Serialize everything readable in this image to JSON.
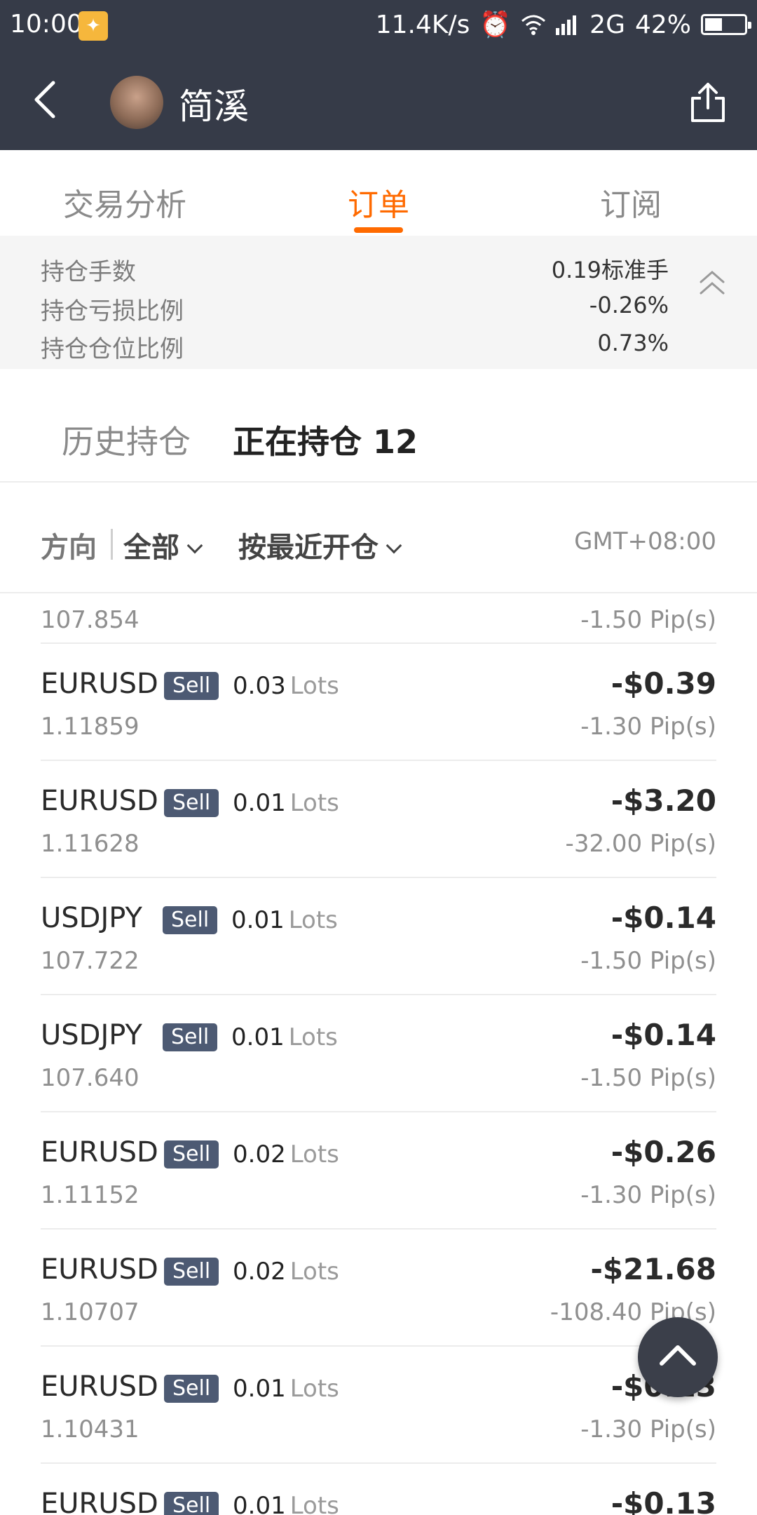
{
  "status_bar": {
    "time": "10:00",
    "speed": "11.4K/s",
    "network": "2G",
    "battery": "42%"
  },
  "header": {
    "title": "简溪",
    "icons": [
      "back-arrow-icon",
      "avatar",
      "share-icon"
    ]
  },
  "tabs": {
    "items": [
      "交易分析",
      "订单",
      "订阅"
    ],
    "active": "订单"
  },
  "summary": {
    "rows": [
      {
        "label": "持仓手数",
        "value": "0.19标准手"
      },
      {
        "label": "持仓亏损比例",
        "value": "-0.26%"
      },
      {
        "label": "持仓仓位比例",
        "value": "0.73%"
      }
    ]
  },
  "subtabs": {
    "history": "历史持仓",
    "current": "正在持仓 12"
  },
  "filter": {
    "direction_label": "方向",
    "direction_value": "全部",
    "sort_value": "按最近开仓",
    "timezone": "GMT+08:00"
  },
  "orders": {
    "partial_top": {
      "price": "107.854",
      "pips": "-1.50 Pip(s)"
    },
    "rows": [
      {
        "symbol": "EURUSD",
        "side": "Sell",
        "lots": "0.03",
        "lots_unit": "Lots",
        "price": "1.11859",
        "pnl": "-$0.39",
        "pips": "-1.30 Pip(s)"
      },
      {
        "symbol": "EURUSD",
        "side": "Sell",
        "lots": "0.01",
        "lots_unit": "Lots",
        "price": "1.11628",
        "pnl": "-$3.20",
        "pips": "-32.00 Pip(s)"
      },
      {
        "symbol": "USDJPY",
        "side": "Sell",
        "lots": "0.01",
        "lots_unit": "Lots",
        "price": "107.722",
        "pnl": "-$0.14",
        "pips": "-1.50 Pip(s)"
      },
      {
        "symbol": "USDJPY",
        "side": "Sell",
        "lots": "0.01",
        "lots_unit": "Lots",
        "price": "107.640",
        "pnl": "-$0.14",
        "pips": "-1.50 Pip(s)"
      },
      {
        "symbol": "EURUSD",
        "side": "Sell",
        "lots": "0.02",
        "lots_unit": "Lots",
        "price": "1.11152",
        "pnl": "-$0.26",
        "pips": "-1.30 Pip(s)"
      },
      {
        "symbol": "EURUSD",
        "side": "Sell",
        "lots": "0.02",
        "lots_unit": "Lots",
        "price": "1.10707",
        "pnl": "-$21.68",
        "pips": "-108.40 Pip(s)"
      },
      {
        "symbol": "EURUSD",
        "side": "Sell",
        "lots": "0.01",
        "lots_unit": "Lots",
        "price": "1.10431",
        "pnl": "-$0.13",
        "pips": "-1.30 Pip(s)"
      },
      {
        "symbol": "EURUSD",
        "side": "Sell",
        "lots": "0.01",
        "lots_unit": "Lots",
        "price": "",
        "pnl": "-$0.13",
        "pips": ""
      }
    ]
  },
  "colors": {
    "header_bg": "#363b48",
    "accent": "#ff6a00",
    "badge_bg": "#4d5a73"
  }
}
